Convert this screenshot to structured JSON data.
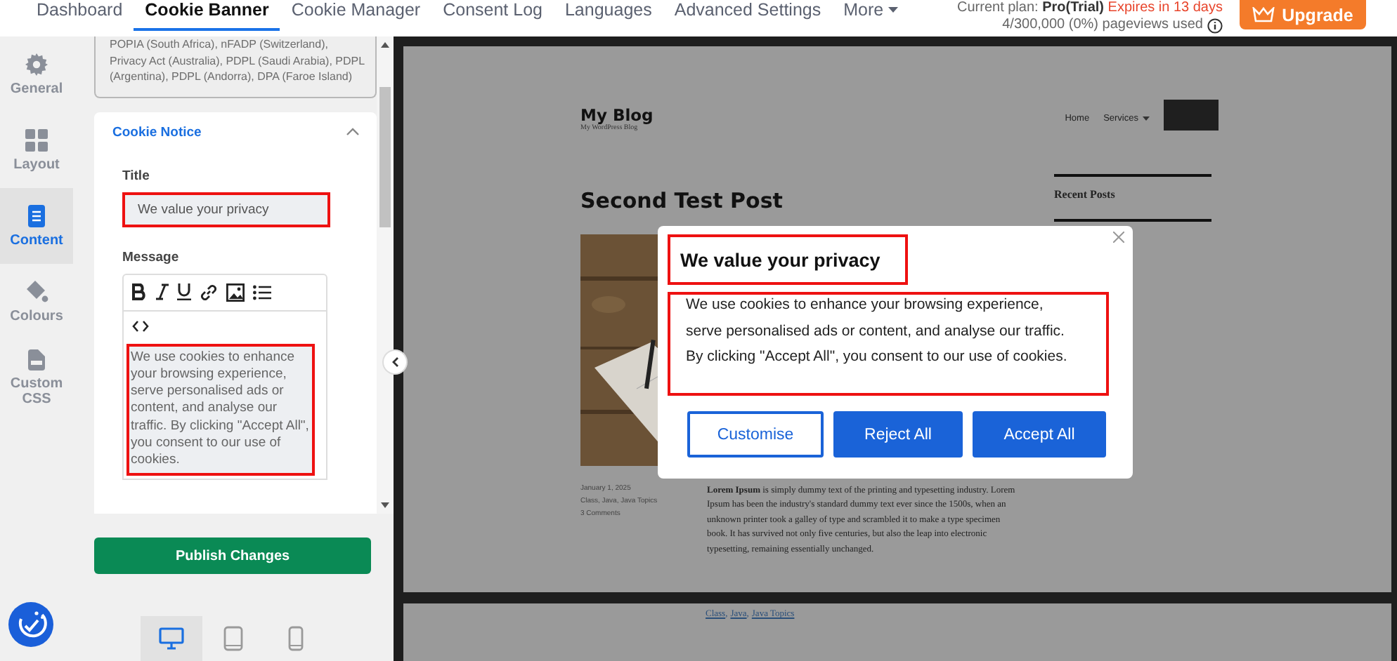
{
  "top_nav": {
    "tabs": [
      {
        "label": "Dashboard",
        "selected": false
      },
      {
        "label": "Cookie Banner",
        "selected": true
      },
      {
        "label": "Cookie Manager",
        "selected": false
      },
      {
        "label": "Consent Log",
        "selected": false
      },
      {
        "label": "Languages",
        "selected": false
      },
      {
        "label": "Advanced Settings",
        "selected": false
      },
      {
        "label": "More",
        "selected": false
      }
    ],
    "plan_label": "Current plan:",
    "plan": "Pro(Trial)",
    "expiry": "Expires in 13 days",
    "usage": "4/300,000 (0%) pageviews used",
    "upgrade_button": "Upgrade"
  },
  "sidebar": {
    "items": [
      {
        "label": "General",
        "kind": "gear",
        "selected": false
      },
      {
        "label": "Layout",
        "kind": "grid",
        "selected": false
      },
      {
        "label": "Content",
        "kind": "document",
        "selected": true
      },
      {
        "label": "Colours",
        "kind": "paint",
        "selected": false
      },
      {
        "label": "Custom CSS",
        "kind": "css",
        "selected": false
      }
    ]
  },
  "panel": {
    "law_list": "POPIA (South Africa), nFADP (Switzerland), Privacy Act (Australia), PDPL (Saudi Arabia), PDPL (Argentina), PDPL (Andorra), DPA (Faroe Island)",
    "section": {
      "title": "Cookie Notice",
      "expanded": true,
      "title_label": "Title",
      "title_value": "We value your privacy",
      "title_highlighted": true,
      "message_label": "Message",
      "message": "We use cookies to enhance your browsing experience, serve personalised ads or content, and analyse our traffic. By clicking \"Accept All\", you consent to our use of cookies.",
      "message_highlighted": true
    },
    "publish_button": "Publish Changes"
  },
  "device_bar": {
    "devices": [
      {
        "kind": "desktop",
        "selected": true
      },
      {
        "kind": "tablet",
        "selected": false
      },
      {
        "kind": "mobile",
        "selected": false
      }
    ]
  },
  "preview": {
    "site_title": "My Blog",
    "tagline": "My WordPress Blog",
    "nav": [
      {
        "label": "Home",
        "kind": "link"
      },
      {
        "label": "Services",
        "kind": "dropdown"
      }
    ],
    "post_title": "Second Test Post",
    "sidebar_heading": "Recent Posts",
    "meta": [
      "January 1, 2025",
      "Class, Java, Java Topics",
      "3 Comments"
    ],
    "body": "**Lorem Ipsum** is simply dummy text of the printing and typesetting industry. Lorem Ipsum has been the industry's standard dummy text ever since the 1500s, when an unknown printer took a galley of type and scrambled it to make a type specimen book. It has survived not only five centuries, but also the leap into electronic typesetting, remaining essentially unchanged.",
    "tags": [
      "Class",
      "Java",
      "Java Topics"
    ],
    "tag_separator": ","
  },
  "cookie_banner": {
    "title": "We value your privacy",
    "title_highlighted": true,
    "message": "We use cookies to enhance your browsing experience, serve personalised ads or content, and analyse our traffic. By clicking \"Accept All\", you consent to our use of cookies.",
    "message_highlighted": true,
    "buttons": [
      {
        "label": "Customise",
        "kind": "outline"
      },
      {
        "label": "Reject All",
        "kind": "filled"
      },
      {
        "label": "Accept All",
        "kind": "filled"
      }
    ]
  }
}
